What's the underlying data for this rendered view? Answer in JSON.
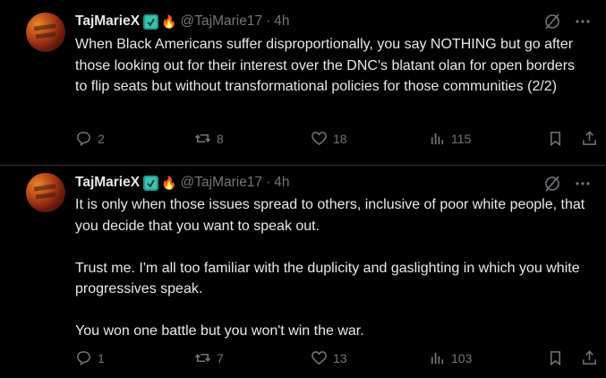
{
  "tweets": [
    {
      "author": {
        "name": "TajMarieX",
        "handle": "@TajMarie17",
        "time": "4h"
      },
      "paragraphs": [
        "When Black Americans suffer disproportionally, you say NOTHING but go after those looking out for their interest over the DNC's blatant olan for open borders to flip seats but without transformational policies for those communities (2/2)"
      ],
      "stats": {
        "replies": "2",
        "reposts": "8",
        "likes": "18",
        "views": "115"
      }
    },
    {
      "author": {
        "name": "TajMarieX",
        "handle": "@TajMarie17",
        "time": "4h"
      },
      "paragraphs": [
        "It is only when those issues spread to others, inclusive of poor white people, that you decide that you want to speak out.",
        "Trust me. I'm all too familiar with the duplicity and gaslighting in which you white progressives speak.",
        "You won one battle but you won't win the war."
      ],
      "stats": {
        "replies": "1",
        "reposts": "7",
        "likes": "13",
        "views": "103"
      }
    }
  ],
  "colors": {
    "background": "#000000",
    "text": "#e7e9ea",
    "muted": "#71767b",
    "divider": "#2f3336"
  },
  "icons": [
    "grok-icon",
    "more-icon",
    "reply-icon",
    "repost-icon",
    "like-icon",
    "views-icon",
    "bookmark-icon",
    "share-icon",
    "verified-badge-icon",
    "flame-icon"
  ]
}
